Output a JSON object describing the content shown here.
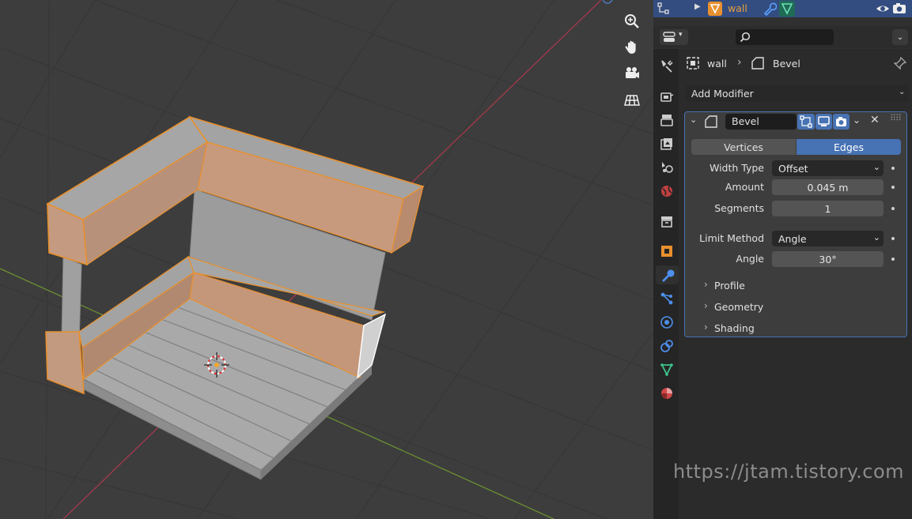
{
  "outliner": {
    "object_name": "wall"
  },
  "properties": {
    "search_placeholder": "",
    "breadcrumb": {
      "object": "wall",
      "modifier": "Bevel"
    },
    "add_modifier_label": "Add Modifier",
    "modifier": {
      "name": "Bevel",
      "affect_options": [
        "Vertices",
        "Edges"
      ],
      "affect_selected": "Edges",
      "fields": {
        "width_type": {
          "label": "Width Type",
          "value": "Offset"
        },
        "amount": {
          "label": "Amount",
          "value": "0.045 m"
        },
        "segments": {
          "label": "Segments",
          "value": "1"
        },
        "limit_method": {
          "label": "Limit Method",
          "value": "Angle"
        },
        "angle": {
          "label": "Angle",
          "value": "30°"
        }
      },
      "subpanels": [
        "Profile",
        "Geometry",
        "Shading"
      ]
    }
  },
  "colors": {
    "accent_blue": "#4772b3",
    "selection_orange": "#e8902e",
    "viewport_bg": "#3d3d3d",
    "panel_bg": "#2b2b2b"
  },
  "icons": {
    "viewport_nav": [
      "zoom-icon",
      "pan-hand-icon",
      "camera-view-icon",
      "ortho-grid-icon"
    ],
    "property_tabs": [
      "tool-icon",
      "render-icon",
      "output-icon",
      "view-layer-icon",
      "scene-icon",
      "world-icon",
      "collection-icon",
      "object-icon",
      "modifier-wrench-icon",
      "particles-icon",
      "physics-icon",
      "constraints-icon",
      "data-icon",
      "material-icon"
    ]
  },
  "watermark": "https://jtam.tistory.com"
}
